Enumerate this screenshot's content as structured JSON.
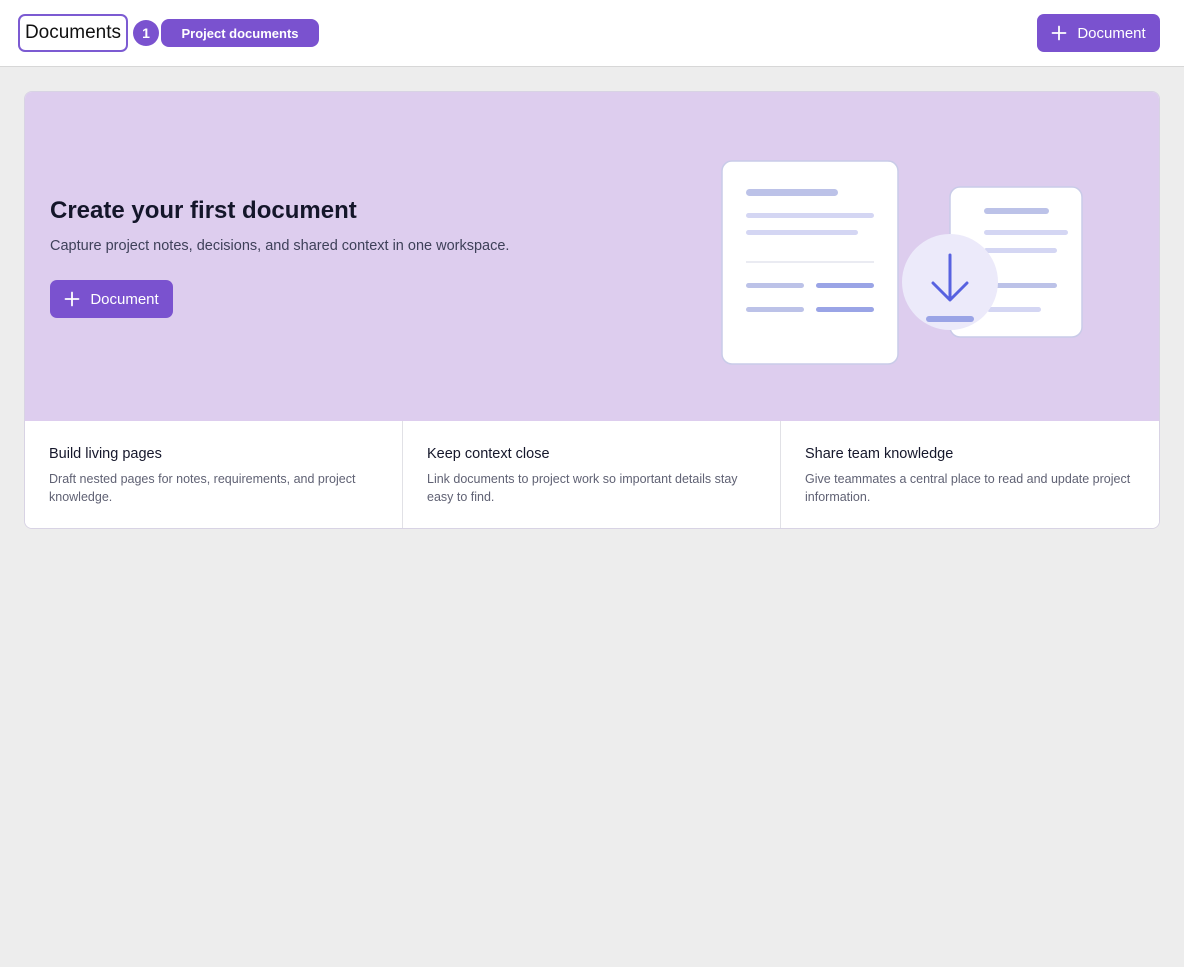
{
  "header": {
    "title": "Documents",
    "count": "1",
    "project_label": "Project documents",
    "add_button_label": "Document"
  },
  "hero": {
    "title": "Create your first document",
    "subtitle": "Capture project notes, decisions, and shared context in one workspace.",
    "button_label": "Document"
  },
  "features": [
    {
      "title": "Build living pages",
      "description": "Draft nested pages for notes, requirements, and project knowledge."
    },
    {
      "title": "Keep context close",
      "description": "Link documents to project work so important details stay easy to find."
    },
    {
      "title": "Share team knowledge",
      "description": "Give teammates a central place to read and update project information."
    }
  ],
  "icons": {
    "add": "plus-icon",
    "illustration": "documents-download-illustration"
  },
  "colors": {
    "accent": "#7a52cf",
    "hero_background": "#ddcdee",
    "page_background": "#ededed"
  }
}
